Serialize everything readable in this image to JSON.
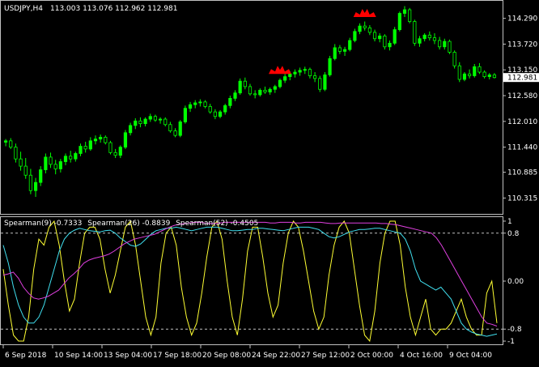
{
  "main": {
    "symbol_timeframe": "USDJPY,H4",
    "ohlc_text": "113.003 113.076 112.962 112.981",
    "current_price": "112.981",
    "price_axis_labels": [
      "114.290",
      "113.720",
      "113.150",
      "112.580",
      "112.010",
      "111.440",
      "110.885",
      "110.315"
    ],
    "candles": [
      [
        111.55,
        111.62,
        111.46,
        111.58
      ],
      [
        111.58,
        111.64,
        111.4,
        111.44
      ],
      [
        111.44,
        111.52,
        111.1,
        111.18
      ],
      [
        111.18,
        111.34,
        110.92,
        111.02
      ],
      [
        111.02,
        111.2,
        110.74,
        110.82
      ],
      [
        110.82,
        110.96,
        110.4,
        110.48
      ],
      [
        110.48,
        110.76,
        110.34,
        110.66
      ],
      [
        110.66,
        111.02,
        110.58,
        110.94
      ],
      [
        110.94,
        111.3,
        110.86,
        111.22
      ],
      [
        111.22,
        111.32,
        110.98,
        111.06
      ],
      [
        111.06,
        111.16,
        110.84,
        110.96
      ],
      [
        110.96,
        111.18,
        110.88,
        111.12
      ],
      [
        111.12,
        111.3,
        111.04,
        111.24
      ],
      [
        111.24,
        111.36,
        111.1,
        111.18
      ],
      [
        111.18,
        111.34,
        111.12,
        111.3
      ],
      [
        111.3,
        111.52,
        111.24,
        111.46
      ],
      [
        111.46,
        111.56,
        111.32,
        111.4
      ],
      [
        111.4,
        111.66,
        111.36,
        111.58
      ],
      [
        111.58,
        111.7,
        111.5,
        111.62
      ],
      [
        111.62,
        111.72,
        111.54,
        111.66
      ],
      [
        111.66,
        111.7,
        111.5,
        111.54
      ],
      [
        111.54,
        111.58,
        111.28,
        111.32
      ],
      [
        111.32,
        111.4,
        111.2,
        111.26
      ],
      [
        111.26,
        111.48,
        111.2,
        111.44
      ],
      [
        111.44,
        111.82,
        111.4,
        111.76
      ],
      [
        111.76,
        111.98,
        111.7,
        111.92
      ],
      [
        111.92,
        112.08,
        111.84,
        112.02
      ],
      [
        112.02,
        112.1,
        111.88,
        111.96
      ],
      [
        111.96,
        112.1,
        111.9,
        112.06
      ],
      [
        112.06,
        112.18,
        112.0,
        112.12
      ],
      [
        112.12,
        112.16,
        112.0,
        112.04
      ],
      [
        112.04,
        112.1,
        111.96,
        112.06
      ],
      [
        112.06,
        112.1,
        111.9,
        111.94
      ],
      [
        111.94,
        112.0,
        111.76,
        111.8
      ],
      [
        111.8,
        111.86,
        111.66,
        111.7
      ],
      [
        111.7,
        112.04,
        111.66,
        112.0
      ],
      [
        112.0,
        112.36,
        111.96,
        112.3
      ],
      [
        112.3,
        112.44,
        112.22,
        112.38
      ],
      [
        112.38,
        112.48,
        112.3,
        112.42
      ],
      [
        112.42,
        112.5,
        112.34,
        112.44
      ],
      [
        112.44,
        112.48,
        112.3,
        112.34
      ],
      [
        112.34,
        112.4,
        112.18,
        112.22
      ],
      [
        112.22,
        112.28,
        112.06,
        112.12
      ],
      [
        112.12,
        112.26,
        112.08,
        112.22
      ],
      [
        112.22,
        112.4,
        112.16,
        112.36
      ],
      [
        112.36,
        112.58,
        112.3,
        112.52
      ],
      [
        112.52,
        112.7,
        112.46,
        112.64
      ],
      [
        112.64,
        112.96,
        112.6,
        112.9
      ],
      [
        112.9,
        112.98,
        112.72,
        112.78
      ],
      [
        112.78,
        112.84,
        112.58,
        112.62
      ],
      [
        112.62,
        112.7,
        112.52,
        112.6
      ],
      [
        112.6,
        112.74,
        112.56,
        112.7
      ],
      [
        112.7,
        112.78,
        112.62,
        112.66
      ],
      [
        112.66,
        112.76,
        112.6,
        112.72
      ],
      [
        112.72,
        112.82,
        112.64,
        112.78
      ],
      [
        112.78,
        112.96,
        112.74,
        112.92
      ],
      [
        112.92,
        113.06,
        112.86,
        113.0
      ],
      [
        113.0,
        113.12,
        112.92,
        113.06
      ],
      [
        113.06,
        113.16,
        112.98,
        113.1
      ],
      [
        113.1,
        113.2,
        113.02,
        113.14
      ],
      [
        113.14,
        113.22,
        113.06,
        113.16
      ],
      [
        113.16,
        113.2,
        112.96,
        113.02
      ],
      [
        113.02,
        113.1,
        112.88,
        112.96
      ],
      [
        112.96,
        113.02,
        112.66,
        112.72
      ],
      [
        112.72,
        113.1,
        112.68,
        113.04
      ],
      [
        113.04,
        113.46,
        113.0,
        113.4
      ],
      [
        113.4,
        113.72,
        113.36,
        113.64
      ],
      [
        113.64,
        113.7,
        113.5,
        113.56
      ],
      [
        113.56,
        113.66,
        113.46,
        113.6
      ],
      [
        113.6,
        113.86,
        113.56,
        113.8
      ],
      [
        113.8,
        114.06,
        113.76,
        114.0
      ],
      [
        114.0,
        114.18,
        113.94,
        114.12
      ],
      [
        114.12,
        114.22,
        114.02,
        114.08
      ],
      [
        114.08,
        114.14,
        113.92,
        113.98
      ],
      [
        113.98,
        114.04,
        113.78,
        113.84
      ],
      [
        113.84,
        113.96,
        113.76,
        113.9
      ],
      [
        113.9,
        113.94,
        113.6,
        113.66
      ],
      [
        113.66,
        113.8,
        113.58,
        113.74
      ],
      [
        113.74,
        114.1,
        113.7,
        114.04
      ],
      [
        114.04,
        114.44,
        114.0,
        114.4
      ],
      [
        114.4,
        114.56,
        114.32,
        114.48
      ],
      [
        114.48,
        114.52,
        114.18,
        114.22
      ],
      [
        114.22,
        114.26,
        113.68,
        113.74
      ],
      [
        113.74,
        113.9,
        113.66,
        113.84
      ],
      [
        113.84,
        113.96,
        113.78,
        113.92
      ],
      [
        113.92,
        114.0,
        113.8,
        113.86
      ],
      [
        113.86,
        113.96,
        113.72,
        113.8
      ],
      [
        113.8,
        113.88,
        113.6,
        113.66
      ],
      [
        113.66,
        113.84,
        113.6,
        113.78
      ],
      [
        113.78,
        113.82,
        113.5,
        113.54
      ],
      [
        113.54,
        113.58,
        113.18,
        113.24
      ],
      [
        113.24,
        113.32,
        112.88,
        112.94
      ],
      [
        112.94,
        113.1,
        112.9,
        113.06
      ],
      [
        113.06,
        113.16,
        112.96,
        113.02
      ],
      [
        113.02,
        113.28,
        112.98,
        113.22
      ],
      [
        113.22,
        113.3,
        113.06,
        113.1
      ],
      [
        113.1,
        113.14,
        112.96,
        113.0
      ],
      [
        113.0,
        113.08,
        112.94,
        113.04
      ],
      [
        113.04,
        113.08,
        112.96,
        112.98
      ]
    ],
    "signals": [
      {
        "index": 55,
        "price": 113.06
      },
      {
        "index": 72,
        "price": 114.32
      }
    ]
  },
  "indicator": {
    "legend_parts": [
      {
        "text": "Spearman(9) -0.7333",
        "color": "#ffffff"
      },
      {
        "text": "Spearman(26) -0.8839",
        "color": "#ffffff"
      },
      {
        "text": "Spearman(52) -0.4505",
        "color": "#ffffff"
      }
    ],
    "axis_labels": [
      {
        "value": 1,
        "text": "1"
      },
      {
        "value": 0.8,
        "text": "0.8"
      },
      {
        "value": 0,
        "text": "0.00"
      },
      {
        "value": -0.8,
        "text": "-0.8"
      },
      {
        "value": -1,
        "text": "-1"
      }
    ],
    "levels": [
      0.8,
      -0.8
    ],
    "series": [
      {
        "color": "#ffff33",
        "values": [
          0.2,
          -0.4,
          -0.9,
          -1.0,
          -1.0,
          -0.6,
          0.2,
          0.7,
          0.6,
          0.9,
          1.0,
          0.6,
          0.0,
          -0.5,
          -0.3,
          0.3,
          0.8,
          0.9,
          0.9,
          0.7,
          0.2,
          -0.2,
          0.1,
          0.5,
          0.9,
          1.0,
          0.6,
          0.0,
          -0.6,
          -0.9,
          -0.6,
          0.3,
          0.8,
          0.9,
          0.6,
          -0.1,
          -0.6,
          -0.9,
          -0.7,
          -0.2,
          0.4,
          0.9,
          1.0,
          0.7,
          0.0,
          -0.6,
          -0.9,
          -0.3,
          0.5,
          0.9,
          0.9,
          0.4,
          -0.2,
          -0.6,
          -0.4,
          0.3,
          0.8,
          1.0,
          0.9,
          0.5,
          0.0,
          -0.5,
          -0.8,
          -0.6,
          0.1,
          0.6,
          0.9,
          1.0,
          0.8,
          0.2,
          -0.4,
          -0.9,
          -1.0,
          -0.5,
          0.3,
          0.8,
          1.0,
          1.0,
          0.6,
          -0.1,
          -0.6,
          -0.9,
          -0.6,
          -0.3,
          -0.8,
          -0.9,
          -0.8,
          -0.8,
          -0.7,
          -0.5,
          -0.3,
          -0.6,
          -0.8,
          -0.9,
          -0.9,
          -0.2,
          0.0,
          -0.7
        ]
      },
      {
        "color": "#40e0f0",
        "values": [
          0.6,
          0.3,
          -0.1,
          -0.4,
          -0.6,
          -0.7,
          -0.7,
          -0.6,
          -0.4,
          -0.1,
          0.2,
          0.5,
          0.7,
          0.8,
          0.85,
          0.88,
          0.86,
          0.84,
          0.83,
          0.82,
          0.84,
          0.85,
          0.8,
          0.72,
          0.66,
          0.6,
          0.58,
          0.62,
          0.7,
          0.78,
          0.84,
          0.86,
          0.88,
          0.88,
          0.9,
          0.88,
          0.86,
          0.84,
          0.86,
          0.88,
          0.9,
          0.9,
          0.9,
          0.88,
          0.86,
          0.84,
          0.84,
          0.85,
          0.86,
          0.86,
          0.88,
          0.88,
          0.87,
          0.86,
          0.85,
          0.84,
          0.86,
          0.88,
          0.9,
          0.9,
          0.9,
          0.88,
          0.86,
          0.8,
          0.74,
          0.72,
          0.74,
          0.78,
          0.82,
          0.84,
          0.86,
          0.86,
          0.87,
          0.88,
          0.88,
          0.86,
          0.84,
          0.82,
          0.8,
          0.7,
          0.5,
          0.2,
          0.0,
          -0.05,
          -0.1,
          -0.15,
          -0.1,
          -0.2,
          -0.3,
          -0.5,
          -0.7,
          -0.8,
          -0.85,
          -0.88,
          -0.9,
          -0.92,
          -0.9,
          -0.88
        ]
      },
      {
        "color": "#e040e0",
        "values": [
          0.1,
          0.12,
          0.15,
          0.05,
          -0.1,
          -0.2,
          -0.28,
          -0.3,
          -0.28,
          -0.25,
          -0.2,
          -0.15,
          -0.05,
          0.05,
          0.12,
          0.2,
          0.3,
          0.35,
          0.38,
          0.4,
          0.42,
          0.45,
          0.5,
          0.56,
          0.62,
          0.66,
          0.7,
          0.72,
          0.74,
          0.76,
          0.78,
          0.82,
          0.86,
          0.9,
          0.93,
          0.95,
          0.96,
          0.97,
          0.98,
          0.98,
          0.97,
          0.96,
          0.96,
          0.97,
          0.98,
          0.98,
          0.98,
          0.98,
          0.98,
          0.98,
          0.98,
          0.98,
          0.98,
          0.97,
          0.97,
          0.98,
          0.98,
          0.98,
          0.97,
          0.97,
          0.98,
          0.98,
          0.98,
          0.98,
          0.97,
          0.96,
          0.96,
          0.97,
          0.97,
          0.97,
          0.97,
          0.97,
          0.97,
          0.97,
          0.97,
          0.96,
          0.96,
          0.95,
          0.94,
          0.92,
          0.9,
          0.88,
          0.86,
          0.84,
          0.82,
          0.8,
          0.72,
          0.6,
          0.45,
          0.3,
          0.15,
          0.0,
          -0.15,
          -0.3,
          -0.45,
          -0.6,
          -0.7,
          -0.72,
          -0.75
        ]
      }
    ]
  },
  "time_axis_labels": [
    "6 Sep 2018",
    "10 Sep 14:00",
    "13 Sep 04:00",
    "17 Sep 18:00",
    "20 Sep 08:00",
    "24 Sep 22:00",
    "27 Sep 12:00",
    "2 Oct 00:00",
    "4 Oct 16:00",
    "9 Oct 04:00"
  ],
  "colors": {
    "background": "#000000",
    "bull_candle": "#00ff00",
    "bear_candle": "#00ff00",
    "signal": "#ff0000",
    "grid_text": "#ffffff",
    "level_line": "#c0c0c0",
    "price_tag_bg": "#ffffff"
  }
}
